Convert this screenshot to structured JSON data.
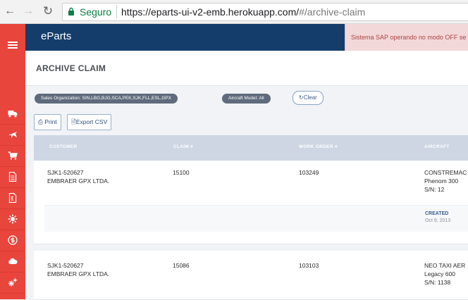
{
  "browser": {
    "secure_label": "Seguro",
    "url_base": "https://eparts-ui-v2-emb.herokuapp.com/",
    "url_hash": "#/archive-claim"
  },
  "header": {
    "brand": "eParts",
    "sap_alert": "Sistema SAP operando no modo OFF se"
  },
  "sidebar": {
    "icons": [
      "truck-icon",
      "plane-icon",
      "cart-icon",
      "document-icon",
      "receipt-icon",
      "refresh-gear-icon",
      "dollar-icon",
      "cloud-icon",
      "gears-icon"
    ]
  },
  "page": {
    "title": "ARCHIVE CLAIM"
  },
  "filters": {
    "sales_org": "Sales Organization: SIN,LBG,BJG,SCA,PEK,SJK,FLL,ESL,GPX",
    "aircraft_model": "Aircraft Model: All",
    "clear_label": "Clear"
  },
  "toolbar": {
    "print_label": "Print",
    "export_label": "Export CSV"
  },
  "table": {
    "columns": [
      "CUSTOMER",
      "CLAIM #",
      "WORK ORDER #",
      "AIRCRAFT"
    ],
    "rows": [
      {
        "customer_code": "SJK1-520627",
        "customer_name": "EMBRAER GPX LTDA.",
        "claim": "15100",
        "work_order": "103249",
        "aircraft_owner": "CONSTREMAC",
        "aircraft_model": "Phenom 300",
        "aircraft_sn": "S/N: 12",
        "created_label": "CREATED",
        "created_date": "Oct 9, 2013"
      },
      {
        "customer_code": "SJK1-520627",
        "customer_name": "EMBRAER GPX LTDA.",
        "claim": "15086",
        "work_order": "103103",
        "aircraft_owner": "NEO TAXI AER",
        "aircraft_model": "Legacy 600",
        "aircraft_sn": "S/N: 1138"
      }
    ]
  },
  "colors": {
    "sidebar": "#e8453c",
    "topbar": "#143d6b",
    "alert_bg": "#f3d8da",
    "table_header": "#cdd6e2"
  }
}
